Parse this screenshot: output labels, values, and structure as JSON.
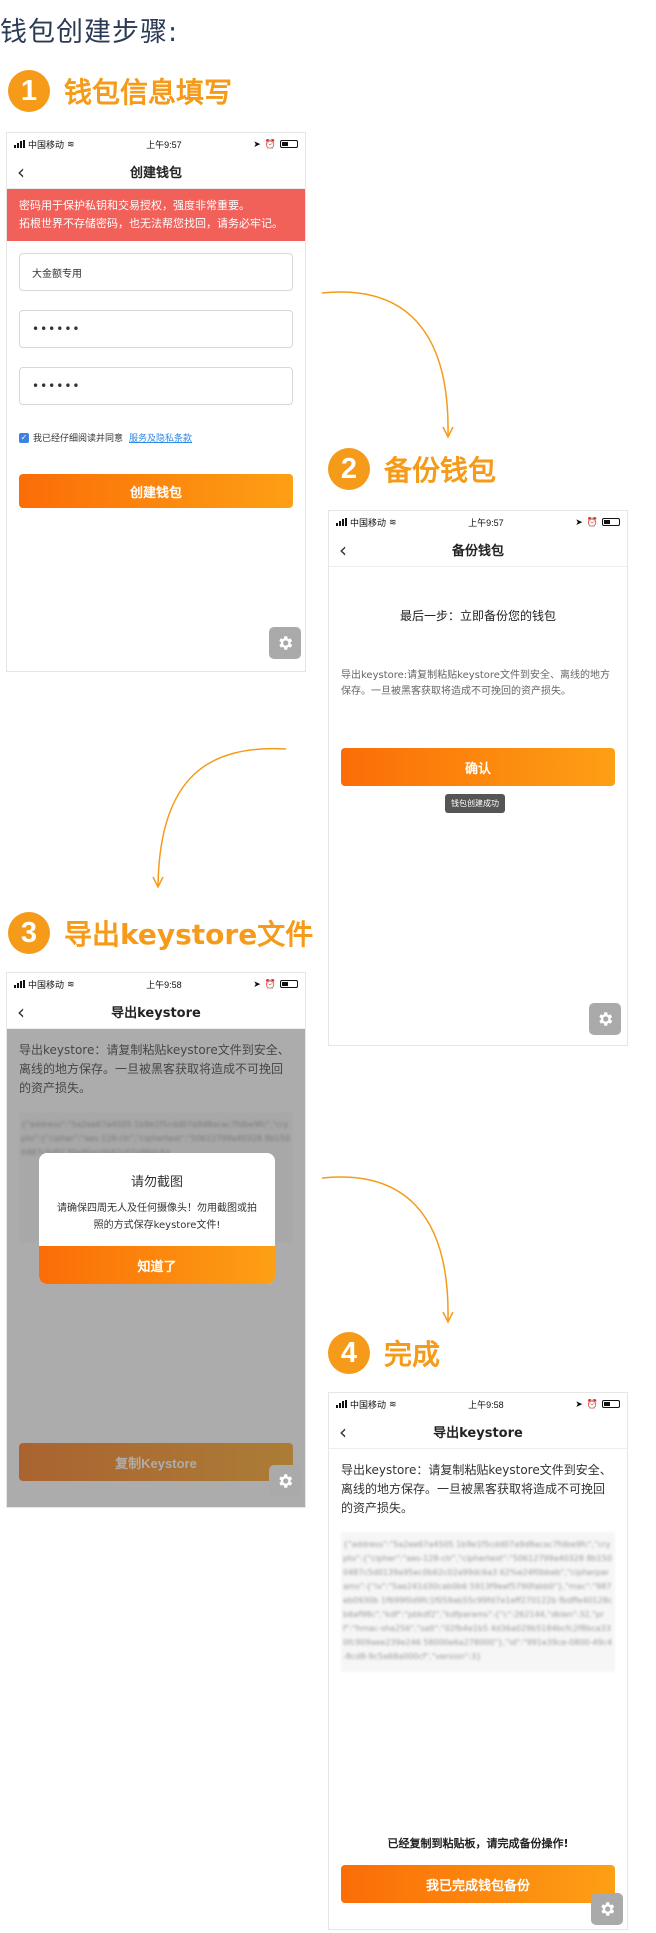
{
  "page_title": "钱包创建步骤:",
  "steps": [
    {
      "num": "1",
      "label": "钱包信息填写"
    },
    {
      "num": "2",
      "label": "备份钱包"
    },
    {
      "num": "3",
      "label": "导出keystore文件"
    },
    {
      "num": "4",
      "label": "完成"
    }
  ],
  "statusbar": [
    {
      "carrier": "中国移动",
      "time": "上午9:57"
    },
    {
      "carrier": "中国移动",
      "time": "上午9:57"
    },
    {
      "carrier": "中国移动",
      "time": "上午9:58"
    },
    {
      "carrier": "中国移动",
      "time": "上午9:58"
    }
  ],
  "screen1": {
    "title": "创建钱包",
    "alert_line1": "密码用于保护私钥和交易授权，强度非常重要。",
    "alert_line2": "拓根世界不存储密码，也无法帮您找回，请务必牢记。",
    "wallet_name": "大金额专用",
    "password": "••••••",
    "password_confirm": "••••••",
    "agree_text": "我已经仔细阅读并同意",
    "terms_link": "服务及隐私条款",
    "create_button": "创建钱包"
  },
  "screen2": {
    "title": "备份钱包",
    "headline": "最后一步：立即备份您的钱包",
    "description": "导出keystore:请复制粘贴keystore文件到安全、离线的地方保存。一旦被黑客获取将造成不可挽回的资产损失。",
    "confirm_button": "确认",
    "toast": "钱包创建成功"
  },
  "screen3": {
    "title": "导出keystore",
    "description": "导出keystore：请复制粘贴keystore文件到安全、离线的地方保存。一旦被黑客获取将造成不可挽回的资产损失。",
    "keystore_blurred": "{\"address\":\"5a2ee67a4505 1b9e1f5cdd07a9d8acac7fdbe9fc\",\"crypto\":{\"cipher\":\"aes-128-ctr\",\"ciphertext\":\"50612799a40328 8b1500487c5d0139a95ec0b62c02a99dc6a",
    "modal_title": "请勿截图",
    "modal_message": "请确保四周无人及任何摄像头！勿用截图或拍照的方式保存keystore文件!",
    "modal_button": "知道了",
    "copy_button": "复制Keystore"
  },
  "screen4": {
    "title": "导出keystore",
    "description": "导出keystore：请复制粘贴keystore文件到安全、离线的地方保存。一旦被黑客获取将造成不可挽回的资产损失。",
    "keystore_blurred": "{\"address\":\"5a2ee67a4505 1b9e1f5cdd07a9d8acac7fdbe9fc\",\"crypto\":{\"cipher\":\"aes-128-ctr\",\"ciphertext\":\"50612799a40328 8b1500487c5d0139a95ec0b62c02a99dc6a3 62%e24f0bbeb\",\"cipherparams\":{\"iv\":\"5ae241d30cab0b6 5913f9eef5790fabb0\"},\"mac\":\"987eb0930b 1f699f0d9fc1f059ab55c99fd7e1eff270122b fbdffe40128cb6af98c\",\"kdf\":\"pbkdf2\",\"kdfparams\":{\"c\":262144,\"dklen\":32,\"prf\":\"hmac-sha256\",\"salt\":\"02fb4e1b5 4d36a029b5184bcfc2f8bca330fc909aee239e246 58000e6a278000\"},\"id\":\"991e39ce-0800-49c4-8cd8-9c5a68a000cf\",\"version\":3}",
    "status": "已经复制到粘贴板，请完成备份操作!",
    "done_button": "我已完成钱包备份"
  },
  "colors": {
    "accent": "#f59b19",
    "alert": "#f2605a",
    "button_start": "#fb6d07",
    "button_end": "#fda014",
    "link": "#2d8ae6"
  }
}
